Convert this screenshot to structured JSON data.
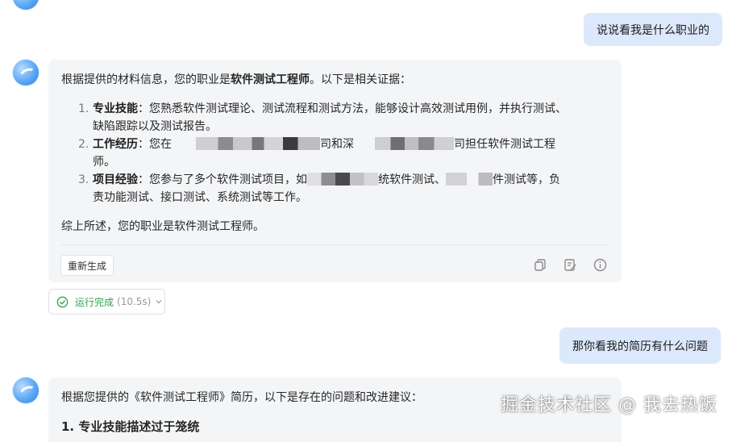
{
  "messages": {
    "user1": "说说看我是什么职业的",
    "ai1": {
      "intro_prefix": "根据提供的材料信息，您的职业是",
      "intro_bold": "软件测试工程师",
      "intro_suffix": "。以下是相关证据：",
      "items": [
        {
          "num": "1.",
          "title": "专业技能",
          "line1": "：您熟悉软件测试理论、测试流程和测试方法，能够设计高效测试用例，并执行测试、",
          "line2": "缺陷跟踪以及测试报告。"
        },
        {
          "num": "2.",
          "title": "工作经历",
          "line1_a": "：您在",
          "line1_b": "司和深",
          "line1_c": "司担任软件测试工程",
          "line2": "师。"
        },
        {
          "num": "3.",
          "title": "项目经验",
          "line1_a": "：您参与了多个软件测试项目，如",
          "line1_b": "统软件测试、",
          "line1_c": "件测试等，负",
          "line2": "责功能测试、接口测试、系统测试等工作。"
        }
      ],
      "summary": "综上所述，您的职业是软件测试工程师。",
      "regenerate": "重新生成"
    },
    "status_label": "运行完成",
    "status_time": "(10.5s)",
    "user2": "那你看我的简历有什么问题",
    "ai2": {
      "intro": "根据您提供的《软件测试工程师》简历，以下是存在的问题和改进建议：",
      "heading": "1. 专业技能描述过于笼统"
    }
  },
  "watermark": "掘金技术社区 @ 我去热饭",
  "colors": {
    "user_bubble": "#dce8fb",
    "ai_card": "#f4f5f7",
    "success": "#2ea44f"
  }
}
